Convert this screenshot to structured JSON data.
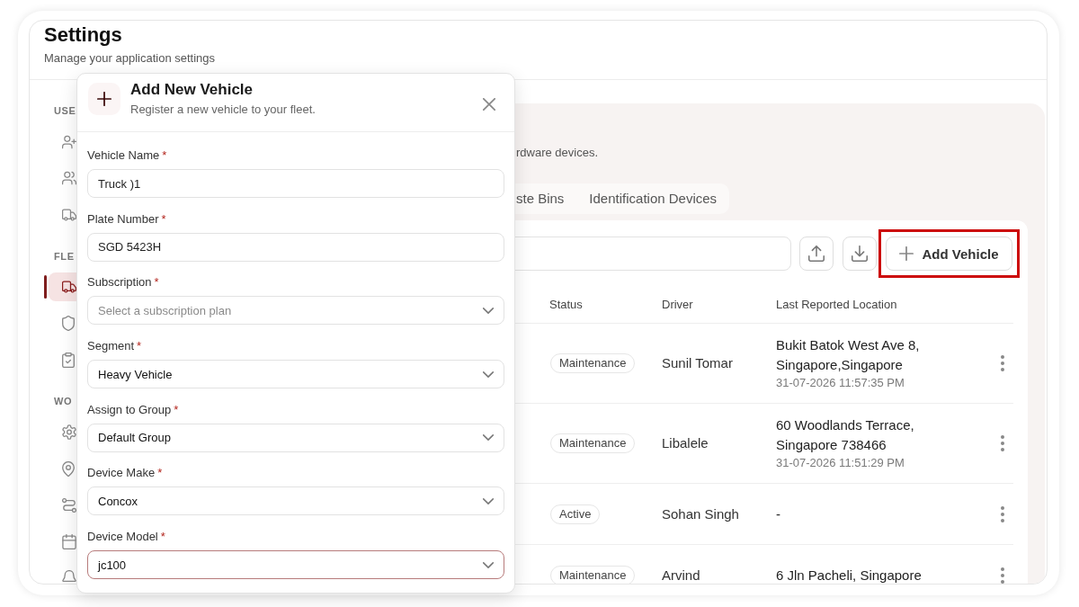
{
  "header": {
    "title": "Settings",
    "subtitle": "Manage your application settings"
  },
  "sidebar": {
    "sections": [
      {
        "label": "USE",
        "items": [
          {
            "selected": false
          },
          {
            "selected": false
          },
          {
            "selected": false
          }
        ]
      },
      {
        "label": "FLE",
        "items": [
          {
            "selected": true
          },
          {
            "selected": false
          },
          {
            "selected": false
          }
        ]
      },
      {
        "label": "WO",
        "items": [
          {
            "selected": false
          },
          {
            "selected": false
          },
          {
            "selected": false
          },
          {
            "selected": false
          },
          {
            "selected": false
          }
        ]
      }
    ]
  },
  "panel": {
    "description": "rdware devices.",
    "tabs": [
      {
        "label": "ste Bins",
        "selected": false
      },
      {
        "label": "Identification Devices",
        "selected": false
      }
    ]
  },
  "toolbar": {
    "add_button": {
      "label": "Add Vehicle",
      "highlighted": true
    }
  },
  "table": {
    "columns": [
      "Status",
      "Driver",
      "Last Reported Location"
    ],
    "rows": [
      {
        "status": "Maintenance",
        "driver": "Sunil Tomar",
        "location": "Bukit Batok West Ave 8, Singapore,Singapore",
        "reported": "31-07-2026 11:57:35 PM"
      },
      {
        "status": "Maintenance",
        "driver": "Libalele",
        "location": "60 Woodlands Terrace, Singapore 738466",
        "reported": "31-07-2026 11:51:29 PM"
      },
      {
        "status": "Active",
        "driver": "Sohan Singh",
        "location": "-"
      },
      {
        "status": "Maintenance",
        "driver": "Arvind",
        "location": "6 Jln Pacheli, Singapore"
      }
    ]
  },
  "dialog": {
    "title": "Add New Vehicle",
    "subtitle": "Register a new vehicle to your fleet.",
    "fields": [
      {
        "label": "Vehicle Name",
        "required_mark": "*",
        "kind": "text",
        "value": "Truck )1",
        "focused": false
      },
      {
        "label": "Plate Number",
        "required_mark": "*",
        "kind": "text",
        "value": "SGD 5423H",
        "focused": false
      },
      {
        "label": "Subscription",
        "required_mark": "*",
        "kind": "select",
        "placeholder": "Select a subscription plan",
        "focused": false
      },
      {
        "label": "Segment",
        "required_mark": "*",
        "kind": "select",
        "value": "Heavy Vehicle",
        "focused": false
      },
      {
        "label": "Assign to Group",
        "required_mark": "*",
        "kind": "select",
        "value": "Default Group",
        "focused": false
      },
      {
        "label": "Device Make",
        "required_mark": "*",
        "kind": "select",
        "value": "Concox",
        "focused": false
      },
      {
        "label": "Device Model",
        "required_mark": "*",
        "kind": "select",
        "value": "jc100",
        "focused": true
      }
    ]
  }
}
